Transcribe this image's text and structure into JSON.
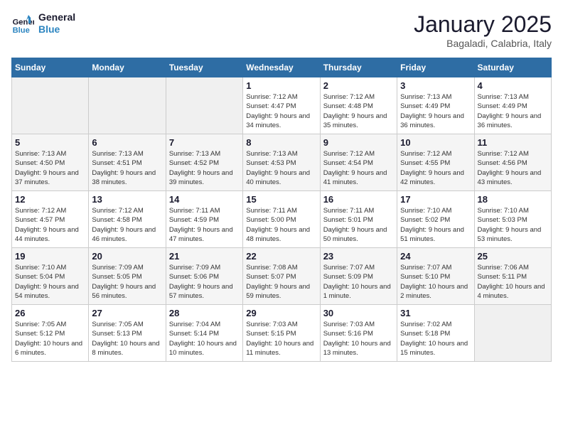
{
  "header": {
    "logo_line1": "General",
    "logo_line2": "Blue",
    "month_title": "January 2025",
    "location": "Bagaladi, Calabria, Italy"
  },
  "weekdays": [
    "Sunday",
    "Monday",
    "Tuesday",
    "Wednesday",
    "Thursday",
    "Friday",
    "Saturday"
  ],
  "weeks": [
    [
      {
        "day": "",
        "empty": true
      },
      {
        "day": "",
        "empty": true
      },
      {
        "day": "",
        "empty": true
      },
      {
        "day": "1",
        "sunrise": "7:12 AM",
        "sunset": "4:47 PM",
        "daylight": "9 hours and 34 minutes."
      },
      {
        "day": "2",
        "sunrise": "7:12 AM",
        "sunset": "4:48 PM",
        "daylight": "9 hours and 35 minutes."
      },
      {
        "day": "3",
        "sunrise": "7:13 AM",
        "sunset": "4:49 PM",
        "daylight": "9 hours and 36 minutes."
      },
      {
        "day": "4",
        "sunrise": "7:13 AM",
        "sunset": "4:49 PM",
        "daylight": "9 hours and 36 minutes."
      }
    ],
    [
      {
        "day": "5",
        "sunrise": "7:13 AM",
        "sunset": "4:50 PM",
        "daylight": "9 hours and 37 minutes."
      },
      {
        "day": "6",
        "sunrise": "7:13 AM",
        "sunset": "4:51 PM",
        "daylight": "9 hours and 38 minutes."
      },
      {
        "day": "7",
        "sunrise": "7:13 AM",
        "sunset": "4:52 PM",
        "daylight": "9 hours and 39 minutes."
      },
      {
        "day": "8",
        "sunrise": "7:13 AM",
        "sunset": "4:53 PM",
        "daylight": "9 hours and 40 minutes."
      },
      {
        "day": "9",
        "sunrise": "7:12 AM",
        "sunset": "4:54 PM",
        "daylight": "9 hours and 41 minutes."
      },
      {
        "day": "10",
        "sunrise": "7:12 AM",
        "sunset": "4:55 PM",
        "daylight": "9 hours and 42 minutes."
      },
      {
        "day": "11",
        "sunrise": "7:12 AM",
        "sunset": "4:56 PM",
        "daylight": "9 hours and 43 minutes."
      }
    ],
    [
      {
        "day": "12",
        "sunrise": "7:12 AM",
        "sunset": "4:57 PM",
        "daylight": "9 hours and 44 minutes."
      },
      {
        "day": "13",
        "sunrise": "7:12 AM",
        "sunset": "4:58 PM",
        "daylight": "9 hours and 46 minutes."
      },
      {
        "day": "14",
        "sunrise": "7:11 AM",
        "sunset": "4:59 PM",
        "daylight": "9 hours and 47 minutes."
      },
      {
        "day": "15",
        "sunrise": "7:11 AM",
        "sunset": "5:00 PM",
        "daylight": "9 hours and 48 minutes."
      },
      {
        "day": "16",
        "sunrise": "7:11 AM",
        "sunset": "5:01 PM",
        "daylight": "9 hours and 50 minutes."
      },
      {
        "day": "17",
        "sunrise": "7:10 AM",
        "sunset": "5:02 PM",
        "daylight": "9 hours and 51 minutes."
      },
      {
        "day": "18",
        "sunrise": "7:10 AM",
        "sunset": "5:03 PM",
        "daylight": "9 hours and 53 minutes."
      }
    ],
    [
      {
        "day": "19",
        "sunrise": "7:10 AM",
        "sunset": "5:04 PM",
        "daylight": "9 hours and 54 minutes."
      },
      {
        "day": "20",
        "sunrise": "7:09 AM",
        "sunset": "5:05 PM",
        "daylight": "9 hours and 56 minutes."
      },
      {
        "day": "21",
        "sunrise": "7:09 AM",
        "sunset": "5:06 PM",
        "daylight": "9 hours and 57 minutes."
      },
      {
        "day": "22",
        "sunrise": "7:08 AM",
        "sunset": "5:07 PM",
        "daylight": "9 hours and 59 minutes."
      },
      {
        "day": "23",
        "sunrise": "7:07 AM",
        "sunset": "5:09 PM",
        "daylight": "10 hours and 1 minute."
      },
      {
        "day": "24",
        "sunrise": "7:07 AM",
        "sunset": "5:10 PM",
        "daylight": "10 hours and 2 minutes."
      },
      {
        "day": "25",
        "sunrise": "7:06 AM",
        "sunset": "5:11 PM",
        "daylight": "10 hours and 4 minutes."
      }
    ],
    [
      {
        "day": "26",
        "sunrise": "7:05 AM",
        "sunset": "5:12 PM",
        "daylight": "10 hours and 6 minutes."
      },
      {
        "day": "27",
        "sunrise": "7:05 AM",
        "sunset": "5:13 PM",
        "daylight": "10 hours and 8 minutes."
      },
      {
        "day": "28",
        "sunrise": "7:04 AM",
        "sunset": "5:14 PM",
        "daylight": "10 hours and 10 minutes."
      },
      {
        "day": "29",
        "sunrise": "7:03 AM",
        "sunset": "5:15 PM",
        "daylight": "10 hours and 11 minutes."
      },
      {
        "day": "30",
        "sunrise": "7:03 AM",
        "sunset": "5:16 PM",
        "daylight": "10 hours and 13 minutes."
      },
      {
        "day": "31",
        "sunrise": "7:02 AM",
        "sunset": "5:18 PM",
        "daylight": "10 hours and 15 minutes."
      },
      {
        "day": "",
        "empty": true
      }
    ]
  ]
}
